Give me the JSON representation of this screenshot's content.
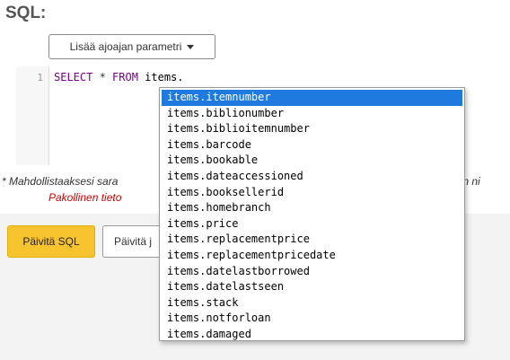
{
  "section": {
    "title": "SQL:"
  },
  "toolbar": {
    "param_button_label": "Lisää ajoajan parametri"
  },
  "editor": {
    "line_number": "1",
    "tokens": {
      "kw1": "SELECT",
      "op1": " * ",
      "kw2": "FROM",
      "ident": " items."
    }
  },
  "hint": {
    "text_left": "* Mahdollistaaksesi sara",
    "text_right": "keen ni",
    "required": "Pakollinen tieto"
  },
  "buttons": {
    "update_sql": "Päivitä SQL",
    "update_secondary": "Päivitä j"
  },
  "autocomplete": {
    "selected_index": 0,
    "items": [
      "items.itemnumber",
      "items.biblionumber",
      "items.biblioitemnumber",
      "items.barcode",
      "items.bookable",
      "items.dateaccessioned",
      "items.booksellerid",
      "items.homebranch",
      "items.price",
      "items.replacementprice",
      "items.replacementpricedate",
      "items.datelastborrowed",
      "items.datelastseen",
      "items.stack",
      "items.notforloan",
      "items.damaged"
    ]
  },
  "colors": {
    "primary_button": "#f7c32e",
    "selection": "#1f7ae0",
    "required_text": "#cc0000",
    "sql_keyword": "#770088"
  }
}
